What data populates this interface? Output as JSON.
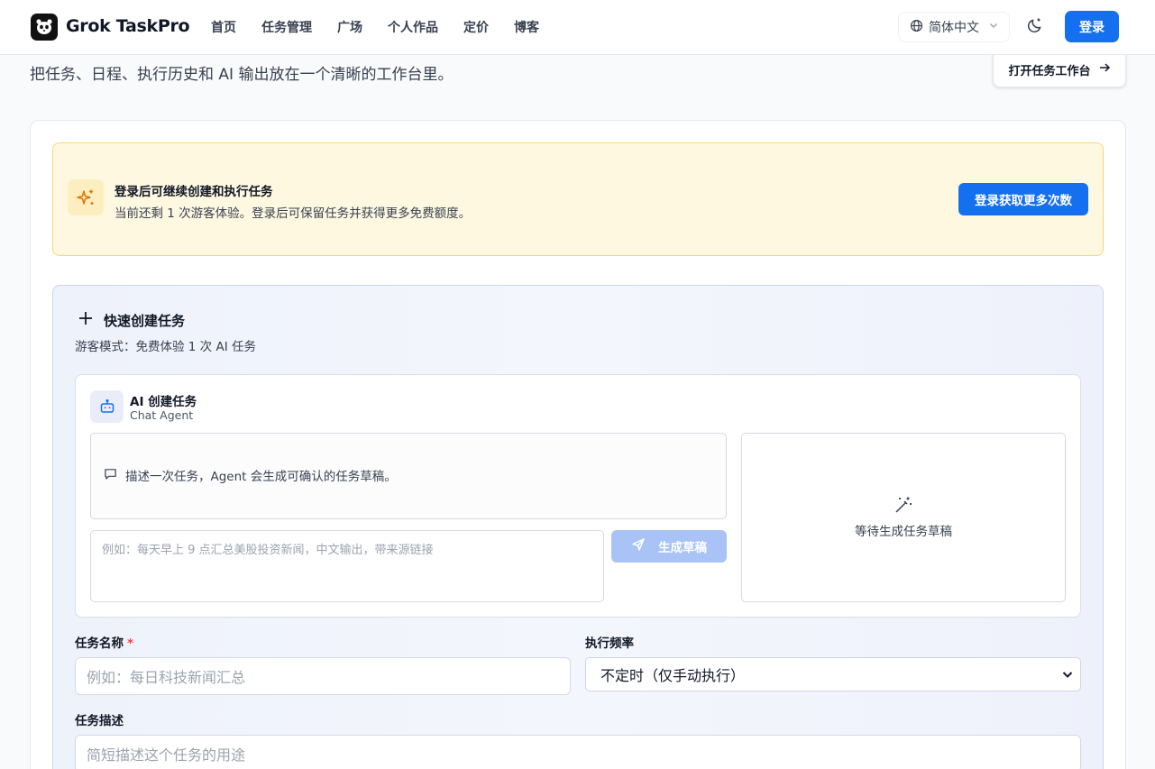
{
  "nav": {
    "brand": "Grok TaskPro",
    "links": [
      "首页",
      "任务管理",
      "广场",
      "个人作品",
      "定价",
      "博客"
    ],
    "language": "简体中文",
    "login": "登录"
  },
  "hero": {
    "subtitle": "把任务、日程、执行历史和 AI 输出放在一个清晰的工作台里。",
    "open_workbench": "打开任务工作台"
  },
  "alert": {
    "title": "登录后可继续创建和执行任务",
    "description": "当前还剩 1 次游客体验。登录后可保留任务并获得更多免费额度。",
    "button": "登录获取更多次数"
  },
  "quick_create": {
    "title": "快速创建任务",
    "subtitle": "游客模式：免费体验 1 次 AI 任务",
    "ai": {
      "title": "AI 创建任务",
      "subtitle": "Chat Agent",
      "chat_hint": "描述一次任务，Agent 会生成可确认的任务草稿。",
      "prompt_placeholder": "例如：每天早上 9 点汇总美股投资新闻，中文输出，带来源链接",
      "generate_button": "生成草稿",
      "draft_placeholder": "等待生成任务草稿"
    },
    "form": {
      "name_label": "任务名称",
      "name_required": "*",
      "name_placeholder": "例如：每日科技新闻汇总",
      "frequency_label": "执行频率",
      "frequency_value": "不定时（仅手动执行）",
      "description_label": "任务描述",
      "description_placeholder": "简短描述这个任务的用途"
    }
  },
  "colors": {
    "primary": "#1570ef",
    "alert_bg": "#fff8e1",
    "alert_border": "#fcd679",
    "panel_border": "#c9d5ee"
  }
}
